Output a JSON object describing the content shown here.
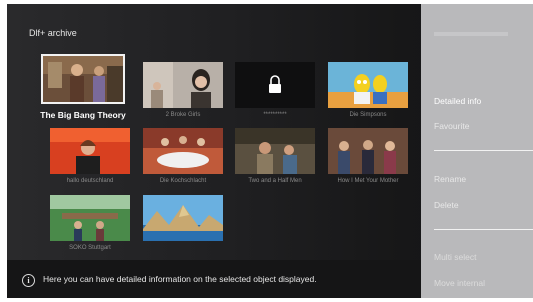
{
  "archive": {
    "title": "Dlf+ archive",
    "tiles": [
      {
        "caption": "The Big Bang Theory",
        "selected": true
      },
      {
        "caption": "2 Broke Girls"
      },
      {
        "caption": "**********",
        "locked": true
      },
      {
        "caption": "Die Simpsons"
      },
      {
        "caption": "hallo deutschland"
      },
      {
        "caption": "Die Kochschlacht"
      },
      {
        "caption": "Two and a Half Men"
      },
      {
        "caption": "How I Met Your Mother"
      },
      {
        "caption": "SOKO Stuttgart"
      },
      {
        "caption": ""
      }
    ]
  },
  "status": {
    "icon": "info-icon",
    "message": "Here you can have detailed information on the selected object displayed."
  },
  "menu": {
    "items": [
      {
        "label": "Detailed info",
        "active": true
      },
      {
        "label": "Favourite"
      },
      {
        "label": "Rename"
      },
      {
        "label": "Delete"
      },
      {
        "label": "Multi select"
      },
      {
        "label": "Move  internal"
      }
    ]
  },
  "colors": {
    "screen_bg": "#1f1f21",
    "menu_bg": "#b9b9bb",
    "selection": "#f2f2f2"
  }
}
